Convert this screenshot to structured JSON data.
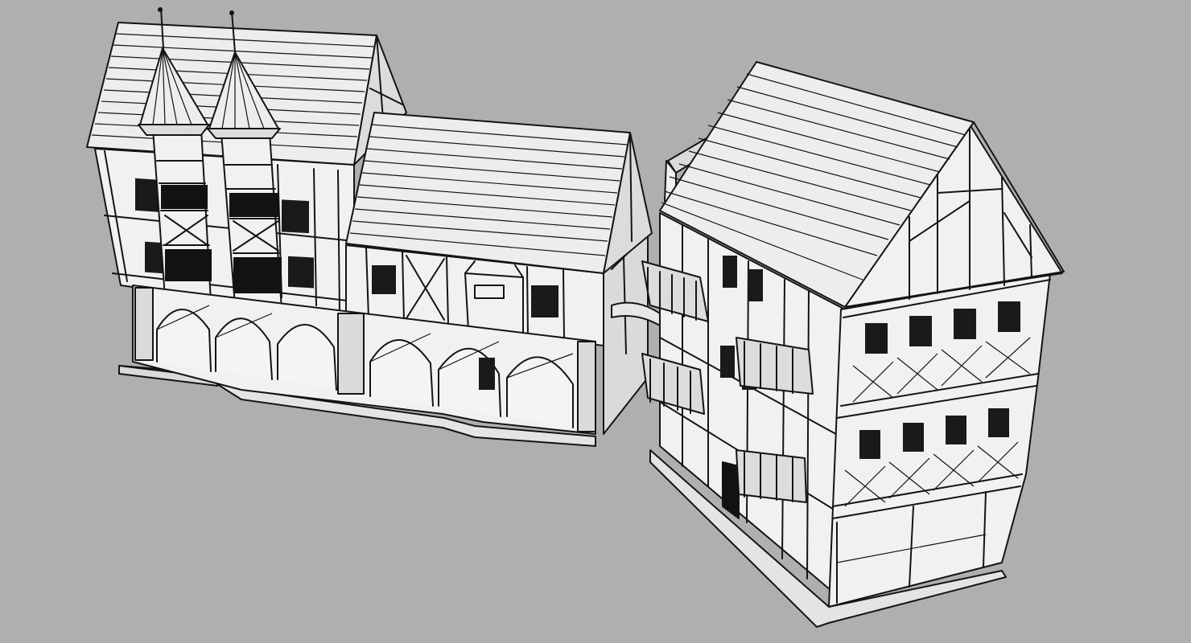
{
  "viewport": {
    "background": "#afafaf",
    "line_color": "#141414",
    "surface_color": "#f0f0f0"
  },
  "scene": {
    "models": [
      {
        "name": "townhouse-with-twin-turrets-and-arcade",
        "style": "half-timbered"
      },
      {
        "name": "tall-half-timbered-house-with-balconies",
        "style": "half-timbered"
      }
    ]
  }
}
